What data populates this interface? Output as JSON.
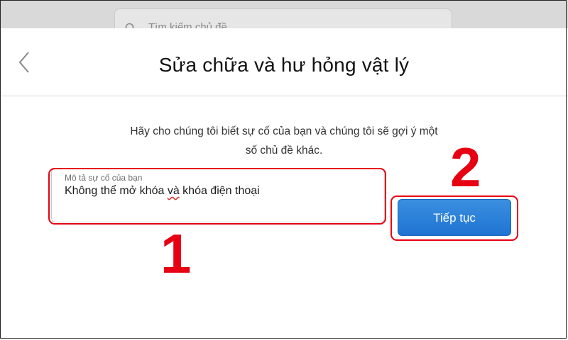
{
  "background": {
    "search_placeholder": "Tìm kiếm chủ đề"
  },
  "dialog": {
    "title": "Sửa chữa và hư hỏng vật lý",
    "instructions_line1": "Hãy cho chúng tôi biết sự cố của bạn và chúng tôi sẽ gợi ý một",
    "instructions_line2": "số chủ đề khác.",
    "description_field": {
      "label": "Mô tả sự cố của bạn",
      "value_part1": "Không thể mở khóa ",
      "value_misspelled": "và",
      "value_part2": " khóa điện thoại"
    },
    "continue_button": "Tiếp tục"
  },
  "annotations": {
    "step1": "1",
    "step2": "2",
    "highlight_color": "#e60012"
  },
  "colors": {
    "button_blue": "#2a7fd9",
    "text": "#1d1d1f"
  }
}
